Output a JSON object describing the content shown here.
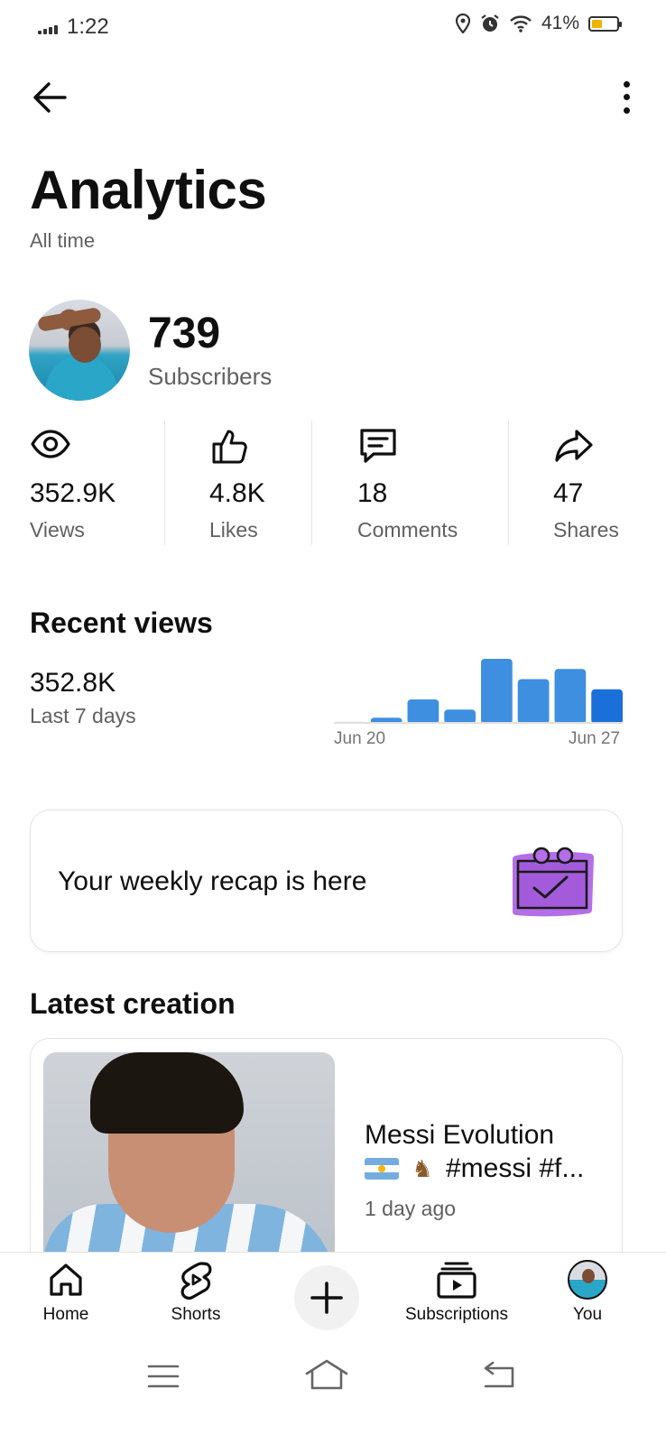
{
  "status_bar": {
    "time": "1:22",
    "battery": "41%",
    "battery_level": 0.41
  },
  "header": {
    "title": "Analytics",
    "subtitle": "All time"
  },
  "channel": {
    "subscribers": "739",
    "subscribers_label": "Subscribers"
  },
  "stats": [
    {
      "value": "352.9K",
      "label": "Views",
      "icon": "eye-icon"
    },
    {
      "value": "4.8K",
      "label": "Likes",
      "icon": "thumbs-up-icon"
    },
    {
      "value": "18",
      "label": "Comments",
      "icon": "comment-icon"
    },
    {
      "value": "47",
      "label": "Shares",
      "icon": "share-icon"
    }
  ],
  "recent_views": {
    "title": "Recent views",
    "value": "352.8K",
    "period": "Last 7 days",
    "x_start": "Jun 20",
    "x_end": "Jun 27"
  },
  "chart_data": {
    "type": "bar",
    "title": "",
    "xlabel": "",
    "ylabel": "",
    "tick_labels": [
      "Jun 20",
      "Jun 27"
    ],
    "values": [
      2,
      6,
      24,
      14,
      64,
      44,
      54,
      34
    ],
    "colors": [
      "#cfcfcf",
      "#3e8fe0",
      "#3e8fe0",
      "#3e8fe0",
      "#3e8fe0",
      "#3e8fe0",
      "#3e8fe0",
      "#1a6fd8"
    ],
    "ylim": [
      0,
      64
    ],
    "grid": false
  },
  "recap": {
    "text": "Your weekly recap is here"
  },
  "latest": {
    "title": "Latest creation",
    "video_title": "Messi Evolution",
    "video_tags": "#messi #f...",
    "posted": "1 day ago"
  },
  "nav": {
    "home": "Home",
    "shorts": "Shorts",
    "subscriptions": "Subscriptions",
    "you": "You"
  }
}
